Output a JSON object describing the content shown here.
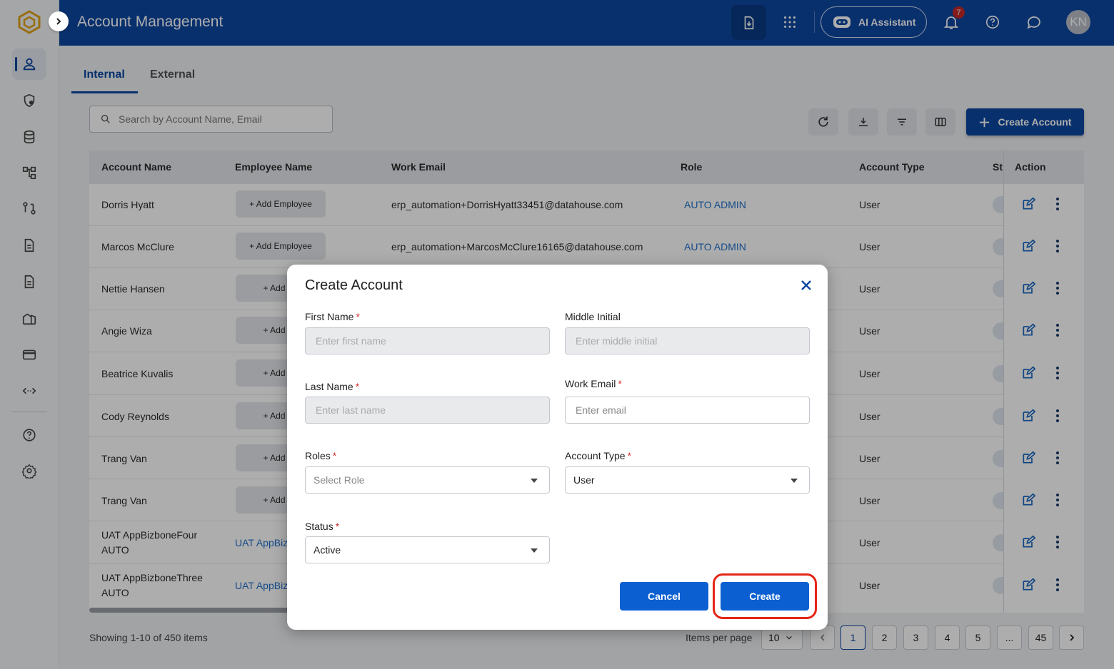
{
  "header": {
    "title": "Account Management",
    "ai_assistant_label": "AI Assistant",
    "notification_count": "7",
    "avatar_initials": "KN"
  },
  "tabs": [
    {
      "label": "Internal",
      "active": true
    },
    {
      "label": "External",
      "active": false
    }
  ],
  "toolbar": {
    "search_placeholder": "Search by Account Name, Email",
    "create_account_label": "Create Account"
  },
  "table": {
    "columns": [
      "Account Name",
      "Employee Name",
      "Work Email",
      "Role",
      "Account Type",
      "St",
      "Action"
    ],
    "add_employee_label": "Add Employee",
    "rows": [
      {
        "account_name": "Dorris Hyatt",
        "employee": "+ Add Employee",
        "email": "erp_automation+DorrisHyatt33451@datahouse.com",
        "role": "AUTO ADMIN",
        "account_type": "User"
      },
      {
        "account_name": "Marcos McClure",
        "employee": "+ Add Employee",
        "email": "erp_automation+MarcosMcClure16165@datahouse.com",
        "role": "AUTO ADMIN",
        "account_type": "User"
      },
      {
        "account_name": "Nettie Hansen",
        "employee": "+ Add En",
        "email": "",
        "role": "",
        "account_type": "User"
      },
      {
        "account_name": "Angie Wiza",
        "employee": "+ Add En",
        "email": "",
        "role": "",
        "account_type": "User"
      },
      {
        "account_name": "Beatrice Kuvalis",
        "employee": "+ Add En",
        "email": "",
        "role": "",
        "account_type": "User"
      },
      {
        "account_name": "Cody Reynolds",
        "employee": "+ Add En",
        "email": "",
        "role": "",
        "account_type": "User"
      },
      {
        "account_name": "Trang Van",
        "employee": "+ Add En",
        "email": "",
        "role": "",
        "account_type": "User"
      },
      {
        "account_name": "Trang Van",
        "employee": "+ Add En",
        "email": "",
        "role": "",
        "account_type": "User"
      },
      {
        "account_name_line1": "UAT AppBizboneFour",
        "account_name_line2": "AUTO",
        "employee_link": "UAT AppBiz",
        "account_type": "User"
      },
      {
        "account_name_line1": "UAT AppBizboneThree",
        "account_name_line2": "AUTO",
        "employee_link": "UAT AppBiz",
        "account_type": "User"
      }
    ]
  },
  "footer": {
    "showing": "Showing 1-10 of 450 items",
    "items_per_page_label": "Items per page",
    "items_per_page": "10",
    "pages": [
      "1",
      "2",
      "3",
      "4",
      "5",
      "...",
      "45"
    ],
    "current_page": "1"
  },
  "modal": {
    "title": "Create Account",
    "first_name": {
      "label": "First Name",
      "placeholder": "Enter first name"
    },
    "middle_initial": {
      "label": "Middle Initial",
      "placeholder": "Enter middle initial"
    },
    "last_name": {
      "label": "Last Name",
      "placeholder": "Enter last name"
    },
    "work_email": {
      "label": "Work Email",
      "placeholder": "Enter email"
    },
    "roles": {
      "label": "Roles",
      "placeholder": "Select Role"
    },
    "account_type": {
      "label": "Account Type",
      "value": "User"
    },
    "status": {
      "label": "Status",
      "value": "Active"
    },
    "required_mark": "*",
    "cancel_label": "Cancel",
    "create_label": "Create"
  },
  "colors": {
    "primary": "#0d47a1",
    "button": "#0b5fd1",
    "highlight": "#e52617",
    "required": "#d32f2f"
  }
}
